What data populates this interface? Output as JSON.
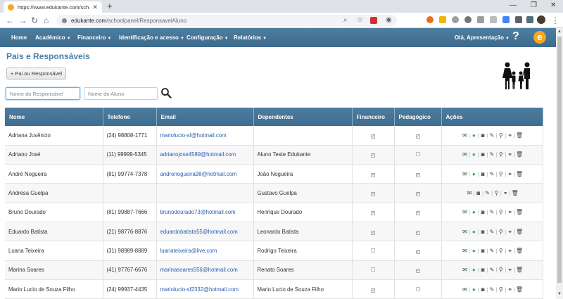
{
  "browser": {
    "tab_title": "https://www.edukante.com/scho",
    "url_domain": "edukante.com",
    "url_path": "/schoolpanel/ResponsavelAluno"
  },
  "nav": {
    "home": "Home",
    "academico": "Acadêmico",
    "financeiro": "Financeiro",
    "identificacao": "Identificação e acesso",
    "configuracao": "Configuração",
    "relatorios": "Relatórios",
    "user_greeting": "Olá, Apresentação",
    "help": "?",
    "brand": "e"
  },
  "page": {
    "title": "Pais e Responsáveis",
    "add_button": "+ Pai ou Responsável"
  },
  "filters": {
    "responsavel_placeholder": "Nome do Responsável",
    "aluno_placeholder": "Nome do Aluno"
  },
  "table": {
    "headers": {
      "nome": "Nome",
      "telefone": "Telefone",
      "email": "Email",
      "dependentes": "Dependentes",
      "financeiro": "Financeiro",
      "pedagogico": "Pedagógico",
      "acoes": "Ações"
    },
    "rows": [
      {
        "nome": "Adriana Juvêncio",
        "telefone": "(24) 98808-1771",
        "email": "mariolucio-sf@hotmail.com",
        "dependentes": "",
        "financeiro": true,
        "pedagogico": true,
        "whatsapp": true
      },
      {
        "nome": "Adriano José",
        "telefone": "(11) 99999-5345",
        "email": "adrianojose4589@hotmail.com",
        "dependentes": "Aluno Teste Edukante",
        "financeiro": true,
        "pedagogico": false,
        "whatsapp": true
      },
      {
        "nome": "André Nogueira",
        "telefone": "(81) 99774-7378",
        "email": "andrenogueira98@hotmail.com",
        "dependentes": "João Nogueira",
        "financeiro": true,
        "pedagogico": true,
        "whatsapp": true
      },
      {
        "nome": "Andresa Guelpa",
        "telefone": "",
        "email": "",
        "dependentes": "Gustavo Guelpa",
        "financeiro": true,
        "pedagogico": true,
        "whatsapp": false
      },
      {
        "nome": "Bruno Dourado",
        "telefone": "(81) 99887-7666",
        "email": "brunodourado73@hotmail.com",
        "dependentes": "Henrique Dourado",
        "financeiro": true,
        "pedagogico": true,
        "whatsapp": true
      },
      {
        "nome": "Eduardo Batista",
        "telefone": "(21) 98776-8876",
        "email": "eduardobatista55@hotmail.com",
        "dependentes": "Leonardo Batista",
        "financeiro": true,
        "pedagogico": true,
        "whatsapp": true
      },
      {
        "nome": "Luana Teixeira",
        "telefone": "(31) 98989-8889",
        "email": "luanateixeira@live.com",
        "dependentes": "Rodrigo Teixeira",
        "financeiro": false,
        "pedagogico": true,
        "whatsapp": true
      },
      {
        "nome": "Marina Soares",
        "telefone": "(41) 97767-6676",
        "email": "marinasoares556@hotmail.com",
        "dependentes": "Renato Soares",
        "financeiro": false,
        "pedagogico": true,
        "whatsapp": true
      },
      {
        "nome": "Mario Lucio de Souza Filho",
        "telefone": "(24) 99937-4435",
        "email": "mariolucio-sf2332@hotmail.com",
        "dependentes": "Mario Lucio de Souza Filho",
        "financeiro": true,
        "pedagogico": false,
        "whatsapp": true
      }
    ]
  },
  "icons": {
    "email": "envelope-icon",
    "whatsapp": "whatsapp-icon",
    "photo": "camera-icon",
    "edit": "edit-icon",
    "view": "magnifier-icon",
    "link": "link-icon",
    "delete": "trash-icon"
  },
  "colors": {
    "nav_bar": "#3e6d8f",
    "title": "#4a7fa8",
    "brand": "#f5a623",
    "link": "#2a5db0",
    "whatsapp": "#2db742"
  }
}
